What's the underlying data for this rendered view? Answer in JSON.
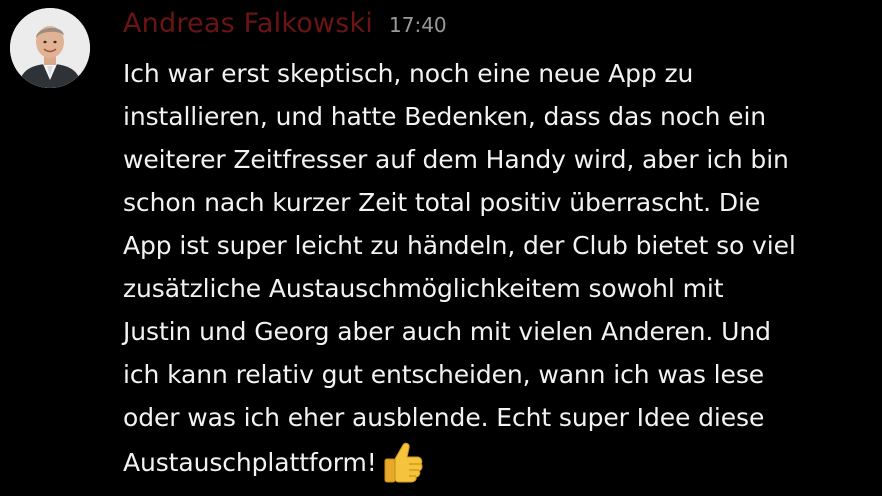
{
  "message": {
    "author": "Andreas Falkowski",
    "timestamp": "17:40",
    "lines": [
      "Ich war erst skeptisch, noch eine neue App zu",
      "installieren, und hatte Bedenken, dass das noch ein",
      "weiterer Zeitfresser auf dem Handy wird, aber ich bin",
      "schon nach kurzer Zeit total positiv überrascht. Die",
      "App ist super leicht zu händeln, der Club bietet so viel",
      "zusätzliche Austauschmöglichkeitem sowohl mit",
      "Justin und Georg aber auch mit vielen Anderen. Und",
      "ich kann relativ gut entscheiden, wann ich was lese",
      "oder was ich eher ausblende. Echt super Idee diese",
      "Austauschplattform!"
    ],
    "emoji": "thumbs-up-icon"
  },
  "colors": {
    "background": "#000000",
    "author": "#6b1414",
    "timestamp": "#9a9a9a",
    "text": "#f2f2f2",
    "emoji": "#f6c33c"
  }
}
